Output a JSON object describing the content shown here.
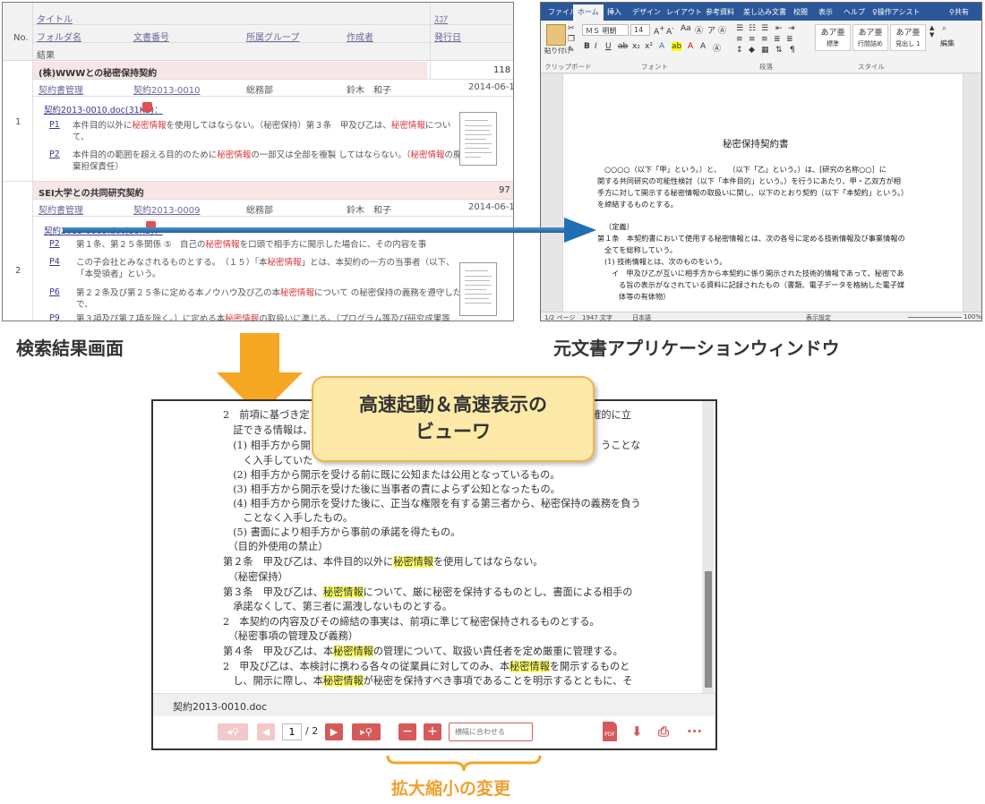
{
  "search_panel": {
    "columns": {
      "no": "No.",
      "title": "タイトル",
      "score": "ｽｺｱ",
      "folder": "フォルダ名",
      "doc_no": "文書番号",
      "group": "所属グループ",
      "author": "作成者",
      "date": "発行日",
      "result": "結果"
    },
    "rows": [
      {
        "no": "1",
        "title": "(株)WWWとの秘密保持契約",
        "score": "118",
        "folder": "契約書管理",
        "doc_no": "契約2013-0010",
        "group": "総務部",
        "author": "鈴木　和子",
        "date": "2014-06-11",
        "file": "契約2013-0010.doc(31KB)：",
        "hits": [
          {
            "page": "P1",
            "pre": "本件目的以外に",
            "kw": "秘密情報",
            "post": "を使用してはならない。（秘密保持）第３条　甲及び乙は、",
            "kw2": "秘密情報",
            "post2": "につい",
            "line2": "て、"
          },
          {
            "page": "P2",
            "pre": "本件目的の範囲を超える目的のために",
            "kw": "秘密情報",
            "post": "の一部又は全部を複製 してはならない。（",
            "kw2": "秘密情報",
            "post2": "の廃",
            "line2": "棄担保責任）"
          }
        ]
      },
      {
        "no": "2",
        "title": "SEI大学との共同研究契約",
        "score": "97",
        "folder": "契約書管理",
        "doc_no": "契約2013-0009",
        "group": "総務部",
        "author": "鈴木　和子",
        "date": "2014-06-11",
        "file": "契約2013-0009.doc(38KB)：",
        "hits": [
          {
            "page": "P2",
            "pre": "第１条、第２５条関係 ⑤　自己の",
            "kw": "秘密情報",
            "post": "を口頭で相手方に開示した場合に、その内容を事",
            "kw2": "",
            "post2": "",
            "line2": ""
          },
          {
            "page": "P4",
            "pre": "この子会社とみなされるものとする。　（１５）「本",
            "kw": "秘密情報",
            "post": "」とは、本契約の一方の当事者（以下、",
            "kw2": "",
            "post2": "",
            "line2": "「本受領者」という。"
          },
          {
            "page": "P6",
            "pre": "第２２条及び第２５条に定める本ノウハウ及び乙の本",
            "kw": "秘密情報",
            "post": "について の秘密保持の義務を遵守した上",
            "kw2": "",
            "post2": "",
            "line2": "で、"
          },
          {
            "page": "P9",
            "pre": "第３項及び第７項を除く。）に定める本",
            "kw": "秘密情報",
            "post": "の取扱いに準じる。（プログラム等及び研究成果等",
            "kw2": "",
            "post2": "",
            "line2": ""
          }
        ]
      }
    ]
  },
  "word_window": {
    "tabs": [
      "ファイル",
      "ホーム",
      "挿入",
      "デザイン",
      "レイアウト",
      "参考資料",
      "差し込み文書",
      "校閲",
      "表示",
      "ヘルプ",
      "操作アシスト",
      "共有"
    ],
    "active_tab": "ホーム",
    "font_name": "ＭＳ 明朝",
    "font_size": "14",
    "paste_label": "貼り付け",
    "groups": [
      "クリップボード",
      "フォント",
      "段落",
      "スタイル",
      "編集"
    ],
    "styles": [
      {
        "sample": "あア亜",
        "name": "標準"
      },
      {
        "sample": "あア亜",
        "name": "行間詰め"
      },
      {
        "sample": "あア亜",
        "name": "見出し 1"
      }
    ],
    "doc": {
      "title": "秘密保持契約書",
      "lines": [
        "○○○○（以下「甲」という。）と、　　（以下「乙」という。）は、[研究の名称○○］に",
        "関する共同研究の可能性検討（以下「本件目的」という。）を行うにあたり、甲・乙双方が相",
        "手方に対して開示する秘密情報の取扱いに関し、以下のとおり契約（以下「本契約」という。）",
        "を締結するものとする。",
        "（定義）",
        "第１条　本契約書において使用する秘密情報とは、次の各号に定める技術情報及び事業情報の",
        "全てを総称していう。",
        "(1) 技術情報とは、次のものをいう。",
        "イ　甲及び乙が互いに相手方から本契約に係り開示された技術的情報であって、秘密であ",
        "る旨の表示がなされている資料に記録されたもの（書類、電子データを格納した電子媒",
        "体等の有体物）"
      ]
    },
    "status": {
      "page": "1/2 ページ",
      "words": "1947 文字",
      "lang": "日本語",
      "display": "表示設定",
      "zoom": "100%"
    }
  },
  "captions": {
    "search": "検索結果画面",
    "app": "元文書アプリケーションウィンドウ",
    "viewer_callout_l1": "高速起動＆高速表示の",
    "viewer_callout_l2": "ビューワ",
    "zoom": "拡大縮小の変更"
  },
  "viewer": {
    "lines": [
      {
        "pre": "2　前項に基づき定",
        "kw": "",
        "post": "",
        "tail": "明確的に立"
      },
      {
        "pre": "　証できる情報は、",
        "kw": "",
        "post": "",
        "tail": ""
      },
      {
        "pre": "　(1) 相手方から開",
        "kw": "",
        "post": "",
        "tail": "うことな"
      },
      {
        "pre": "　　く入手していた",
        "kw": "",
        "post": "",
        "tail": ""
      },
      {
        "pre": "　(2) 相手方から開示を受ける前に既に公知または公用となっているもの。",
        "kw": "",
        "post": "",
        "tail": ""
      },
      {
        "pre": "　(3) 相手方から開示を受けた後に当事者の責によらず公知となったもの。",
        "kw": "",
        "post": "",
        "tail": ""
      },
      {
        "pre": "　(4) 相手方から開示を受けた後に、正当な権限を有する第三者から、秘密保持の義務を負う",
        "kw": "",
        "post": "",
        "tail": ""
      },
      {
        "pre": "　　ことなく入手したもの。",
        "kw": "",
        "post": "",
        "tail": ""
      },
      {
        "pre": "　(5) 書面により相手方から事前の承諾を得たもの。",
        "kw": "",
        "post": "",
        "tail": ""
      },
      {
        "pre": "　（目的外使用の禁止）",
        "kw": "",
        "post": "",
        "tail": ""
      },
      {
        "pre": "第２条　甲及び乙は、本件目的以外に",
        "kw": "秘密情報",
        "post": "を使用してはならない。",
        "tail": ""
      },
      {
        "pre": "　（秘密保持）",
        "kw": "",
        "post": "",
        "tail": ""
      },
      {
        "pre": "第３条　甲及び乙は、",
        "kw": "秘密情報",
        "post": "について、厳に秘密を保持するものとし、書面による相手の",
        "tail": ""
      },
      {
        "pre": "　承諾なくして、第三者に漏洩しないものとする。",
        "kw": "",
        "post": "",
        "tail": ""
      },
      {
        "pre": "2　本契約の内容及びその締結の事実は、前項に準じて秘密保持されるものとする。",
        "kw": "",
        "post": "",
        "tail": ""
      },
      {
        "pre": "　（秘密事項の管理及び義務）",
        "kw": "",
        "post": "",
        "tail": ""
      },
      {
        "pre": "第４条　甲及び乙は、本",
        "kw": "秘密情報",
        "post": "の管理について、取扱い責任者を定め厳重に管理する。",
        "tail": ""
      },
      {
        "pre": "2　甲及び乙は、本検討に携わる各々の従業員に対してのみ、本",
        "kw": "秘密情報",
        "post": "を開示するものと",
        "tail": ""
      },
      {
        "pre": "　し、開示に際し、本",
        "kw": "秘密情報",
        "post": "が秘密を保持すべき事項であることを明示するとともに、そ",
        "tail": ""
      }
    ],
    "filename": "契約2013-0010.doc",
    "page_current": "1",
    "page_total": "/ 2",
    "zoom_placeholder": "横幅に合わせる",
    "pdf_label": "PDF",
    "more_label": "···"
  },
  "colors": {
    "accent_red": "#d65a5a",
    "highlight": "#ffff66",
    "word_blue": "#2b579a",
    "arrow_blue": "#1f6fb5",
    "arrow_orange": "#f5a623"
  }
}
